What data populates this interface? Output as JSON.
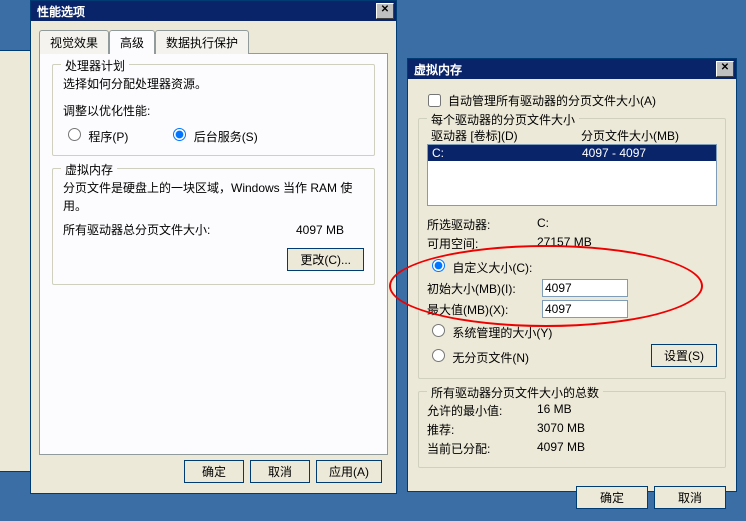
{
  "perf": {
    "title": "性能选项",
    "tabs": {
      "visual": "视觉效果",
      "advanced": "高级",
      "dep": "数据执行保护"
    },
    "processor": {
      "legend": "处理器计划",
      "desc": "选择如何分配处理器资源。",
      "adjustLabel": "调整以优化性能:",
      "radioPrograms": "程序(P)",
      "radioServices": "后台服务(S)"
    },
    "vm": {
      "legend": "虚拟内存",
      "desc": "分页文件是硬盘上的一块区域，Windows 当作 RAM 使用。",
      "totalLabel": "所有驱动器总分页文件大小:",
      "totalValue": "4097 MB",
      "changeBtn": "更改(C)..."
    },
    "buttons": {
      "ok": "确定",
      "cancel": "取消",
      "apply": "应用(A)"
    }
  },
  "vmdlg": {
    "title": "虚拟内存",
    "autoManage": "自动管理所有驱动器的分页文件大小(A)",
    "perDrive": {
      "legend": "每个驱动器的分页文件大小",
      "colDrive": "驱动器 [卷标](D)",
      "colSize": "分页文件大小(MB)",
      "driveC": "C:",
      "driveCVal": "4097 - 4097",
      "selDriveLabel": "所选驱动器:",
      "selDriveVal": "C:",
      "freeLabel": "可用空间:",
      "freeVal": "27157 MB",
      "radioCustom": "自定义大小(C):",
      "initLabel": "初始大小(MB)(I):",
      "initVal": "4097",
      "maxLabel": "最大值(MB)(X):",
      "maxVal": "4097",
      "radioSystem": "系统管理的大小(Y)",
      "radioNone": "无分页文件(N)",
      "setBtn": "设置(S)"
    },
    "totals": {
      "legend": "所有驱动器分页文件大小的总数",
      "minLabel": "允许的最小值:",
      "minVal": "16 MB",
      "recLabel": "推荐:",
      "recVal": "3070 MB",
      "curLabel": "当前已分配:",
      "curVal": "4097 MB"
    },
    "buttons": {
      "ok": "确定",
      "cancel": "取消"
    }
  }
}
